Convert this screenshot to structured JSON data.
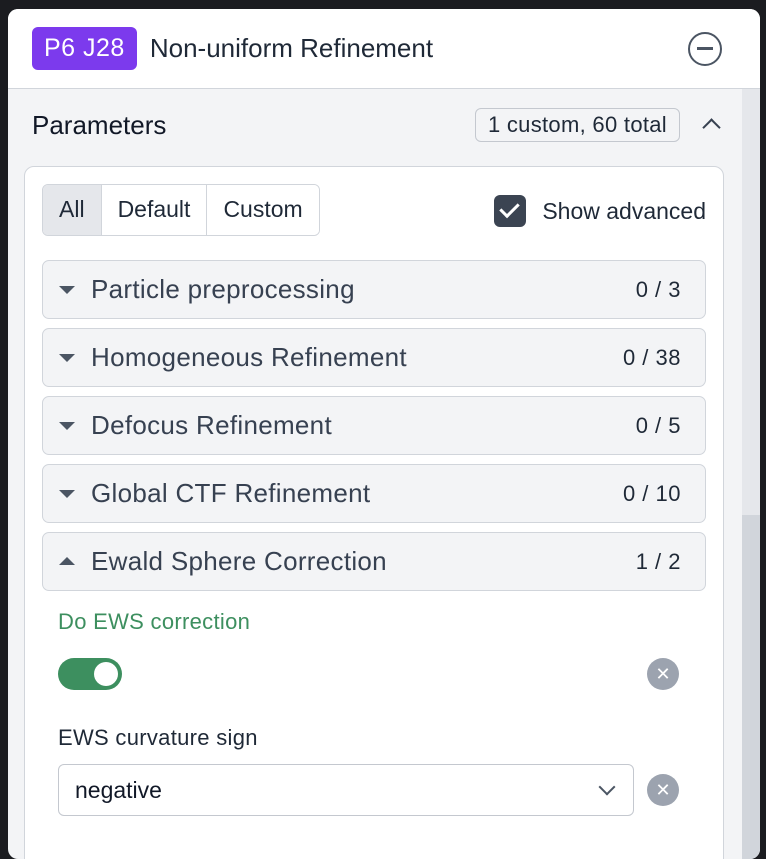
{
  "header": {
    "job_id": "P6 J28",
    "title": "Non-uniform Refinement",
    "collapse_icon": "minus-circle-icon"
  },
  "parameters": {
    "title": "Parameters",
    "count": "1 custom, 60 total",
    "filters": [
      "All",
      "Default",
      "Custom"
    ],
    "active_filter": "All",
    "show_advanced_label": "Show advanced",
    "show_advanced_checked": true
  },
  "sections": [
    {
      "label": "Particle preprocessing",
      "count": "0 / 3",
      "expanded": false
    },
    {
      "label": "Homogeneous Refinement",
      "count": "0 / 38",
      "expanded": false
    },
    {
      "label": "Defocus Refinement",
      "count": "0 / 5",
      "expanded": false
    },
    {
      "label": "Global CTF Refinement",
      "count": "0 / 10",
      "expanded": false
    },
    {
      "label": "Ewald Sphere Correction",
      "count": "1 / 2",
      "expanded": true
    }
  ],
  "fields": {
    "do_ews": {
      "label": "Do EWS correction",
      "value": true
    },
    "ews_sign": {
      "label": "EWS curvature sign",
      "value": "negative"
    }
  },
  "colors": {
    "badge": "#7c3aed",
    "accent_green": "#3d8f5f"
  }
}
